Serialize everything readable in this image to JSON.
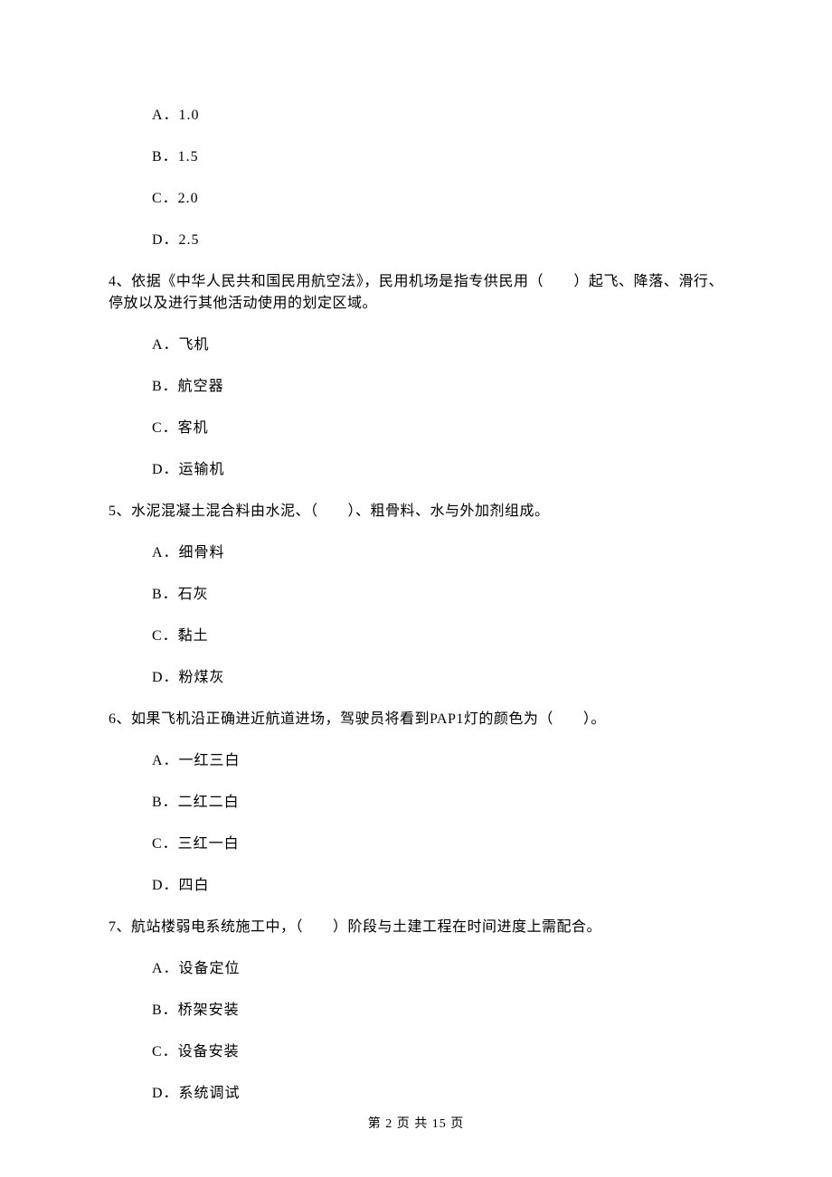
{
  "q3_options": {
    "a": "A．1.0",
    "b": "B．1.5",
    "c": "C．2.0",
    "d": "D．2.5"
  },
  "q4": {
    "text": "4、依据《中华人民共和国民用航空法》，民用机场是指专供民用（　　）起飞、降落、滑行、停放以及进行其他活动使用的划定区域。",
    "a": "A．飞机",
    "b": "B．航空器",
    "c": "C．客机",
    "d": "D．运输机"
  },
  "q5": {
    "text": "5、水泥混凝土混合料由水泥、（　　）、粗骨料、水与外加剂组成。",
    "a": "A．细骨料",
    "b": "B．石灰",
    "c": "C．黏土",
    "d": "D．粉煤灰"
  },
  "q6": {
    "text": "6、如果飞机沿正确进近航道进场，驾驶员将看到PAP1灯的颜色为（　　）。",
    "a": "A．一红三白",
    "b": "B．二红二白",
    "c": "C．三红一白",
    "d": "D．四白"
  },
  "q7": {
    "text": "7、航站楼弱电系统施工中，（　　）阶段与土建工程在时间进度上需配合。",
    "a": "A．设备定位",
    "b": "B．桥架安装",
    "c": "C．设备安装",
    "d": "D．系统调试"
  },
  "footer": "第 2 页 共 15 页"
}
